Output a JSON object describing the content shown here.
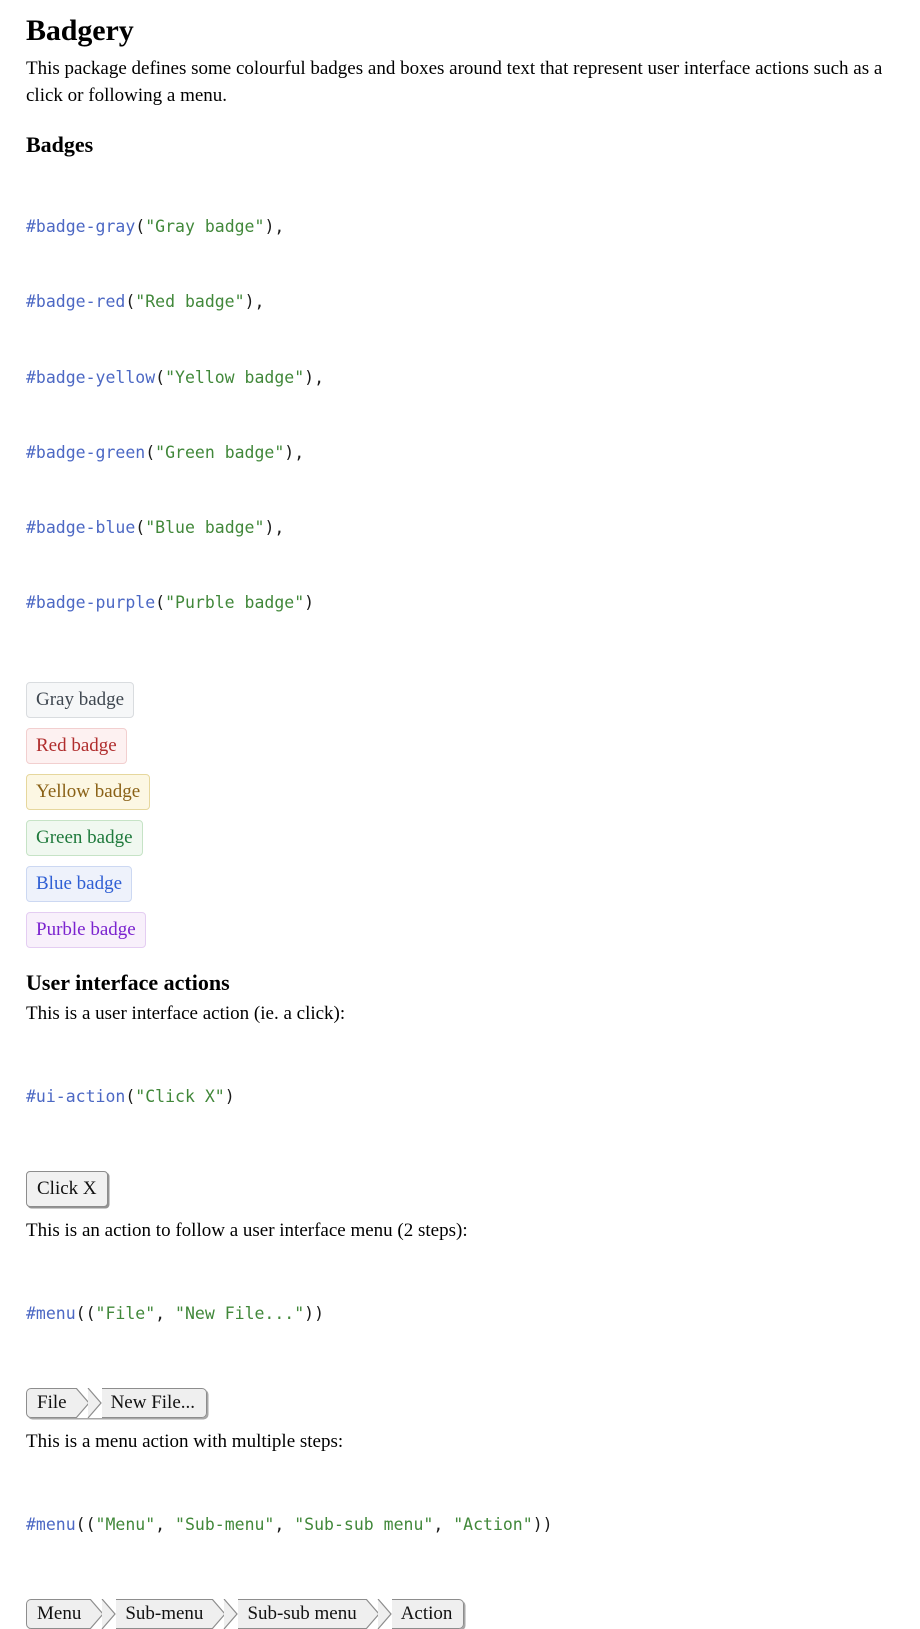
{
  "document": {
    "title": "Badgery",
    "intro": "This package defines some colourful badges and boxes around text that represent user interface actions such as a click or following a menu."
  },
  "badges_section": {
    "heading": "Badges",
    "code": [
      {
        "fn": "#badge-gray",
        "open": "(",
        "str": "\"Gray badge\"",
        "close": "),"
      },
      {
        "fn": "#badge-red",
        "open": "(",
        "str": "\"Red badge\"",
        "close": "),"
      },
      {
        "fn": "#badge-yellow",
        "open": "(",
        "str": "\"Yellow badge\"",
        "close": "),"
      },
      {
        "fn": "#badge-green",
        "open": "(",
        "str": "\"Green badge\"",
        "close": "),"
      },
      {
        "fn": "#badge-blue",
        "open": "(",
        "str": "\"Blue badge\"",
        "close": "),"
      },
      {
        "fn": "#badge-purple",
        "open": "(",
        "str": "\"Purble badge\"",
        "close": ")"
      }
    ],
    "badges": [
      {
        "label": "Gray badge",
        "variant": "gray",
        "bg": "#f6f7f8",
        "border": "#d9dcdf",
        "text": "#3f4750"
      },
      {
        "label": "Red badge",
        "variant": "red",
        "bg": "#fdf1f1",
        "border": "#f2cfcf",
        "text": "#b02d2d"
      },
      {
        "label": "Yellow badge",
        "variant": "yellow",
        "bg": "#fcf7e3",
        "border": "#e6d79d",
        "text": "#8a6116"
      },
      {
        "label": "Green badge",
        "variant": "green",
        "bg": "#f0f8f0",
        "border": "#c6e3c6",
        "text": "#1f7a3c"
      },
      {
        "label": "Blue badge",
        "variant": "blue",
        "bg": "#eef2fb",
        "border": "#ccd8f2",
        "text": "#2f5fd4"
      },
      {
        "label": "Purble badge",
        "variant": "purple",
        "bg": "#f8f0fb",
        "border": "#e4cdf2",
        "text": "#7b23cf"
      }
    ]
  },
  "ui_section": {
    "heading": "User interface actions",
    "click_intro": "This is a user interface action (ie. a click):",
    "click_code": {
      "fn": "#ui-action",
      "open": "(",
      "str": "\"Click X\"",
      "close": ")"
    },
    "click_button": "Click X",
    "menu2_intro": "This is an action to follow a user interface menu (2 steps):",
    "menu2_code": {
      "fn": "#menu",
      "open": "((",
      "str1": "\"File\"",
      "comma": ", ",
      "str2": "\"New File...\"",
      "close": "))"
    },
    "menu2_steps": [
      "File",
      "New File..."
    ],
    "menu_multi_intro": "This is a menu action with multiple steps:",
    "menu_multi_code": {
      "fn": "#menu",
      "open": "((",
      "str1": "\"Menu\"",
      "comma1": ", ",
      "str2": "\"Sub-menu\"",
      "comma2": ", ",
      "str3": "\"Sub-sub menu\"",
      "comma3": ", ",
      "str4": "\"Action\"",
      "close": "))"
    },
    "menu_multi_steps": [
      "Menu",
      "Sub-menu",
      "Sub-sub menu",
      "Action"
    ]
  },
  "theme": {
    "code_fn_color": "#4c68c4",
    "code_str_color": "#41883a",
    "code_punct_color": "#1a1a1a",
    "button_bg": "#f1f1f1",
    "button_border": "#8d8d8d",
    "page_bg": "#ffffff",
    "text_color": "#000000"
  }
}
